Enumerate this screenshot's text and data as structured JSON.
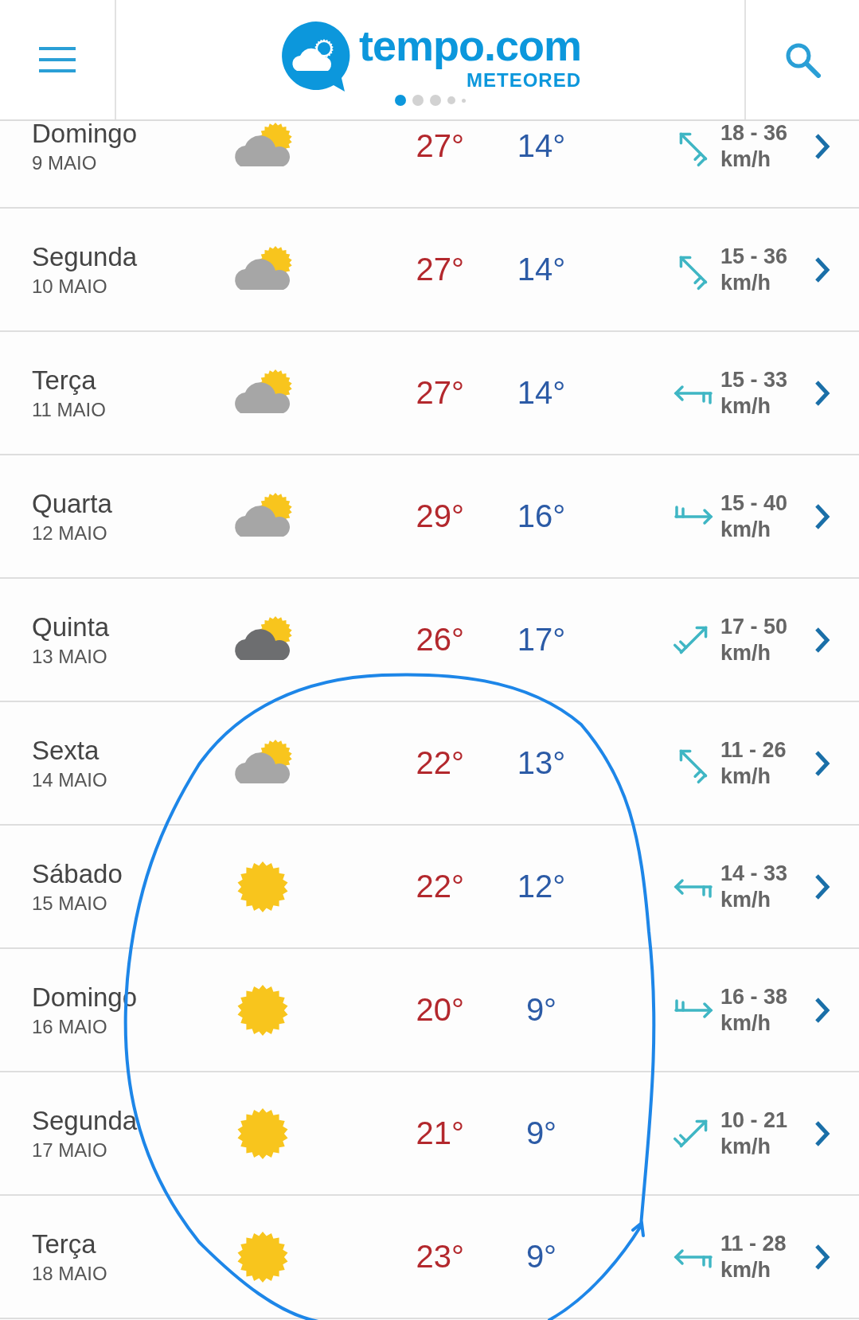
{
  "header": {
    "logo_text": "tempo.com",
    "logo_subtext": "METEORED",
    "page_dots": [
      {
        "selected": true
      },
      {
        "selected": false
      },
      {
        "selected": false
      },
      {
        "selected": false
      },
      {
        "selected": false
      }
    ]
  },
  "days": [
    {
      "day": "Domingo",
      "date": "9 MAIO",
      "sky_icon": {
        "kind": "partlycloudy"
      },
      "high": "27°",
      "low": "14°",
      "wind_icon": {
        "kind": "northwest"
      },
      "wind": "18 - 36",
      "unit": "km/h"
    },
    {
      "day": "Segunda",
      "date": "10 MAIO",
      "sky_icon": {
        "kind": "partlycloudy"
      },
      "high": "27°",
      "low": "14°",
      "wind_icon": {
        "kind": "northwest"
      },
      "wind": "15 - 36",
      "unit": "km/h"
    },
    {
      "day": "Terça",
      "date": "11 MAIO",
      "sky_icon": {
        "kind": "partlycloudy"
      },
      "high": "27°",
      "low": "14°",
      "wind_icon": {
        "kind": "west"
      },
      "wind": "15 - 33",
      "unit": "km/h"
    },
    {
      "day": "Quarta",
      "date": "12 MAIO",
      "sky_icon": {
        "kind": "partlycloudy"
      },
      "high": "29°",
      "low": "16°",
      "wind_icon": {
        "kind": "east"
      },
      "wind": "15 - 40",
      "unit": "km/h"
    },
    {
      "day": "Quinta",
      "date": "13 MAIO",
      "sky_icon": {
        "kind": "darkcloud"
      },
      "high": "26°",
      "low": "17°",
      "wind_icon": {
        "kind": "northeast"
      },
      "wind": "17 - 50",
      "unit": "km/h"
    },
    {
      "day": "Sexta",
      "date": "14 MAIO",
      "sky_icon": {
        "kind": "partlycloudy"
      },
      "high": "22°",
      "low": "13°",
      "wind_icon": {
        "kind": "northwest"
      },
      "wind": "11 - 26",
      "unit": "km/h"
    },
    {
      "day": "Sábado",
      "date": "15 MAIO",
      "sky_icon": {
        "kind": "sunny"
      },
      "high": "22°",
      "low": "12°",
      "wind_icon": {
        "kind": "west"
      },
      "wind": "14 - 33",
      "unit": "km/h"
    },
    {
      "day": "Domingo",
      "date": "16 MAIO",
      "sky_icon": {
        "kind": "sunny"
      },
      "high": "20°",
      "low": "9°",
      "wind_icon": {
        "kind": "east"
      },
      "wind": "16 - 38",
      "unit": "km/h"
    },
    {
      "day": "Segunda",
      "date": "17 MAIO",
      "sky_icon": {
        "kind": "sunny"
      },
      "high": "21°",
      "low": "9°",
      "wind_icon": {
        "kind": "northeast"
      },
      "wind": "10 - 21",
      "unit": "km/h"
    },
    {
      "day": "Terça",
      "date": "18 MAIO",
      "sky_icon": {
        "kind": "sunny"
      },
      "high": "23°",
      "low": "9°",
      "wind_icon": {
        "kind": "west"
      },
      "wind": "11 - 28",
      "unit": "km/h"
    }
  ],
  "annotation": {
    "kind": "freehand"
  }
}
